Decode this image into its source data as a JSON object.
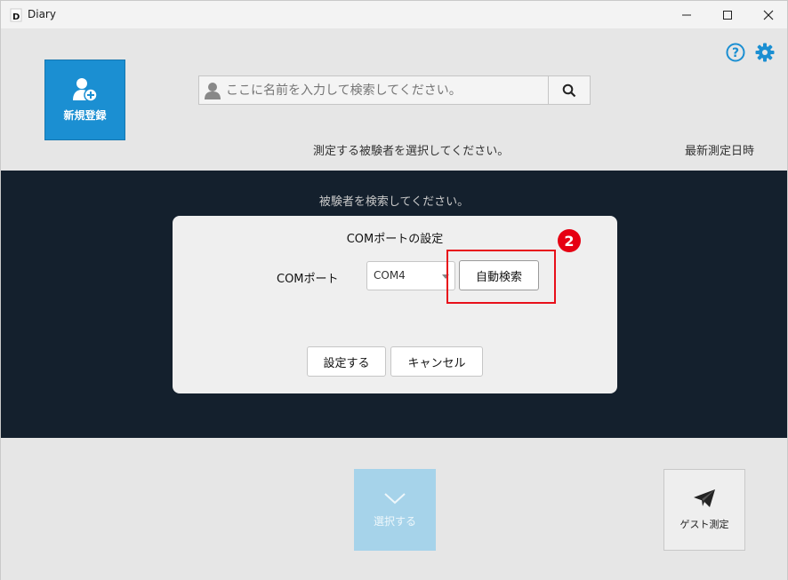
{
  "window": {
    "title": "Diary"
  },
  "header": {
    "new_register_label": "新規登録",
    "search_placeholder": "ここに名前を入力して検索してください。",
    "instruction": "測定する被験者を選択してください。",
    "latest_measure_col": "最新測定日時"
  },
  "list": {
    "empty_message": "被験者を検索してください。"
  },
  "dialog": {
    "title": "COMポートの設定",
    "com_label": "COMポート",
    "com_value": "COM4",
    "auto_search_label": "自動検索",
    "set_label": "設定する",
    "cancel_label": "キャンセル"
  },
  "annotation": {
    "step": "2",
    "color": "#e60012"
  },
  "footer": {
    "select_label": "選択する",
    "guest_label": "ゲスト測定"
  },
  "colors": {
    "accent": "#1b8fd2",
    "list_bg": "#14202d",
    "disabled": "#a6d3ea"
  }
}
